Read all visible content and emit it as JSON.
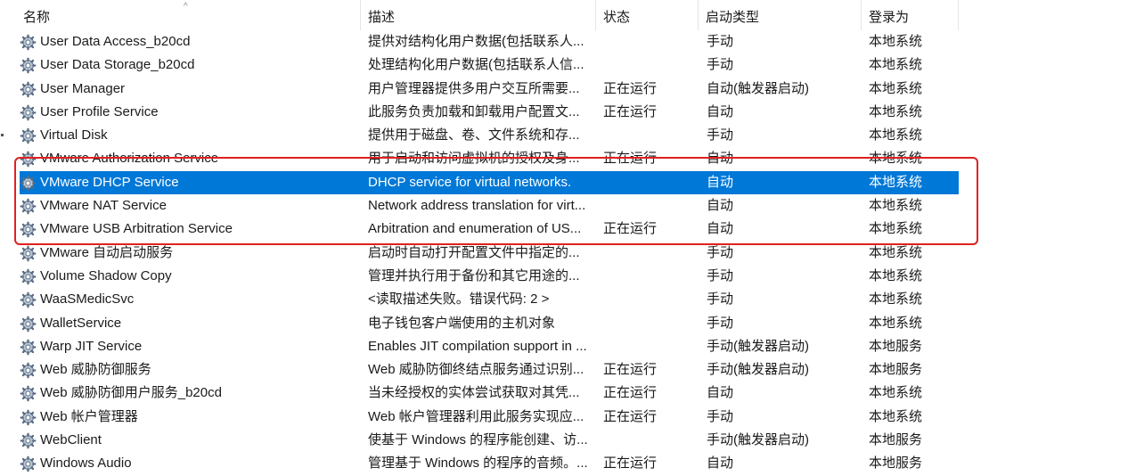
{
  "header": {
    "columns": {
      "name": "名称",
      "description": "描述",
      "status": "状态",
      "startup_type": "启动类型",
      "log_on_as": "登录为"
    },
    "sort_indicator": "^"
  },
  "services": [
    {
      "name": "User Data Access_b20cd",
      "description": "提供对结构化用户数据(包括联系人...",
      "status": "",
      "startup_type": "手动",
      "log_on_as": "本地系统"
    },
    {
      "name": "User Data Storage_b20cd",
      "description": "处理结构化用户数据(包括联系人信...",
      "status": "",
      "startup_type": "手动",
      "log_on_as": "本地系统"
    },
    {
      "name": "User Manager",
      "description": "用户管理器提供多用户交互所需要...",
      "status": "正在运行",
      "startup_type": "自动(触发器启动)",
      "log_on_as": "本地系统"
    },
    {
      "name": "User Profile Service",
      "description": "此服务负责加载和卸载用户配置文...",
      "status": "正在运行",
      "startup_type": "自动",
      "log_on_as": "本地系统"
    },
    {
      "name": "Virtual Disk",
      "description": "提供用于磁盘、卷、文件系统和存...",
      "status": "",
      "startup_type": "手动",
      "log_on_as": "本地系统"
    },
    {
      "name": "VMware Authorization Service",
      "description": "用于启动和访问虚拟机的授权及身...",
      "status": "正在运行",
      "startup_type": "自动",
      "log_on_as": "本地系统"
    },
    {
      "name": "VMware DHCP Service",
      "description": "DHCP service for virtual networks.",
      "status": "",
      "startup_type": "自动",
      "log_on_as": "本地系统",
      "selected": true
    },
    {
      "name": "VMware NAT Service",
      "description": "Network address translation for virt...",
      "status": "",
      "startup_type": "自动",
      "log_on_as": "本地系统"
    },
    {
      "name": "VMware USB Arbitration Service",
      "description": "Arbitration and enumeration of US...",
      "status": "正在运行",
      "startup_type": "自动",
      "log_on_as": "本地系统"
    },
    {
      "name": "VMware 自动启动服务",
      "description": "启动时自动打开配置文件中指定的...",
      "status": "",
      "startup_type": "手动",
      "log_on_as": "本地系统"
    },
    {
      "name": "Volume Shadow Copy",
      "description": "管理并执行用于备份和其它用途的...",
      "status": "",
      "startup_type": "手动",
      "log_on_as": "本地系统"
    },
    {
      "name": "WaaSMedicSvc",
      "description": "<读取描述失败。错误代码: 2 >",
      "status": "",
      "startup_type": "手动",
      "log_on_as": "本地系统"
    },
    {
      "name": "WalletService",
      "description": "电子钱包客户端使用的主机对象",
      "status": "",
      "startup_type": "手动",
      "log_on_as": "本地系统"
    },
    {
      "name": "Warp JIT Service",
      "description": "Enables JIT compilation support in ...",
      "status": "",
      "startup_type": "手动(触发器启动)",
      "log_on_as": "本地服务"
    },
    {
      "name": "Web 威胁防御服务",
      "description": "Web 威胁防御终结点服务通过识别...",
      "status": "正在运行",
      "startup_type": "手动(触发器启动)",
      "log_on_as": "本地服务"
    },
    {
      "name": "Web 威胁防御用户服务_b20cd",
      "description": "当未经授权的实体尝试获取对其凭...",
      "status": "正在运行",
      "startup_type": "自动",
      "log_on_as": "本地系统"
    },
    {
      "name": "Web 帐户管理器",
      "description": "Web 帐户管理器利用此服务实现应...",
      "status": "正在运行",
      "startup_type": "手动",
      "log_on_as": "本地系统"
    },
    {
      "name": "WebClient",
      "description": "使基于 Windows 的程序能创建、访...",
      "status": "",
      "startup_type": "手动(触发器启动)",
      "log_on_as": "本地服务"
    },
    {
      "name": "Windows Audio",
      "description": "管理基于 Windows 的程序的音频。...",
      "status": "正在运行",
      "startup_type": "自动",
      "log_on_as": "本地服务"
    }
  ],
  "colors": {
    "selection": "#0078d7",
    "annotation_box": "#e02020"
  },
  "icons": {
    "row_icon": "gear-service-icon"
  }
}
